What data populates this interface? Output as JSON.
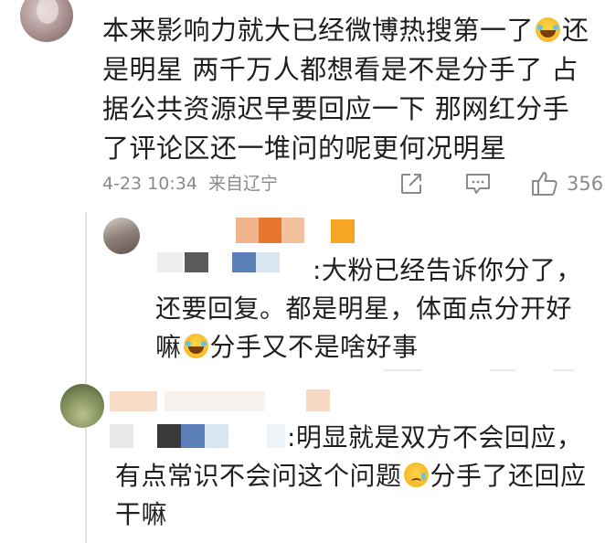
{
  "comment": {
    "text_part1": "本来影响力就大已经微博热搜第一了",
    "text_part2": "还是明星 两千万人都想看是不是分手了 占据公共资源迟早要回应一下 那网红分手了评论区还一堆问的呢更何况明星",
    "timestamp": "4-23 10:34",
    "source": "来自辽宁",
    "like_count": "356"
  },
  "replies": [
    {
      "text_part1": ":大粉已经告诉你分了，还要回复。都是明星，体面点分开好嘛",
      "text_part2": "分手又不是啥好事"
    },
    {
      "text_part1": ":明显就是双方不会回应，有点常识不会问这个问题",
      "text_part2": "分手了还回应干嘛"
    }
  ],
  "icons": {
    "share": "share-icon",
    "comment": "comment-icon",
    "like": "thumbs-up-icon",
    "emoji_laugh": "laughing-tears-emoji",
    "emoji_sad": "sad-tear-emoji"
  },
  "colors": {
    "meta_gray": "#8a8a8a",
    "mosaic_orange": "#e8762c",
    "mosaic_blue": "#5a7fb8"
  }
}
